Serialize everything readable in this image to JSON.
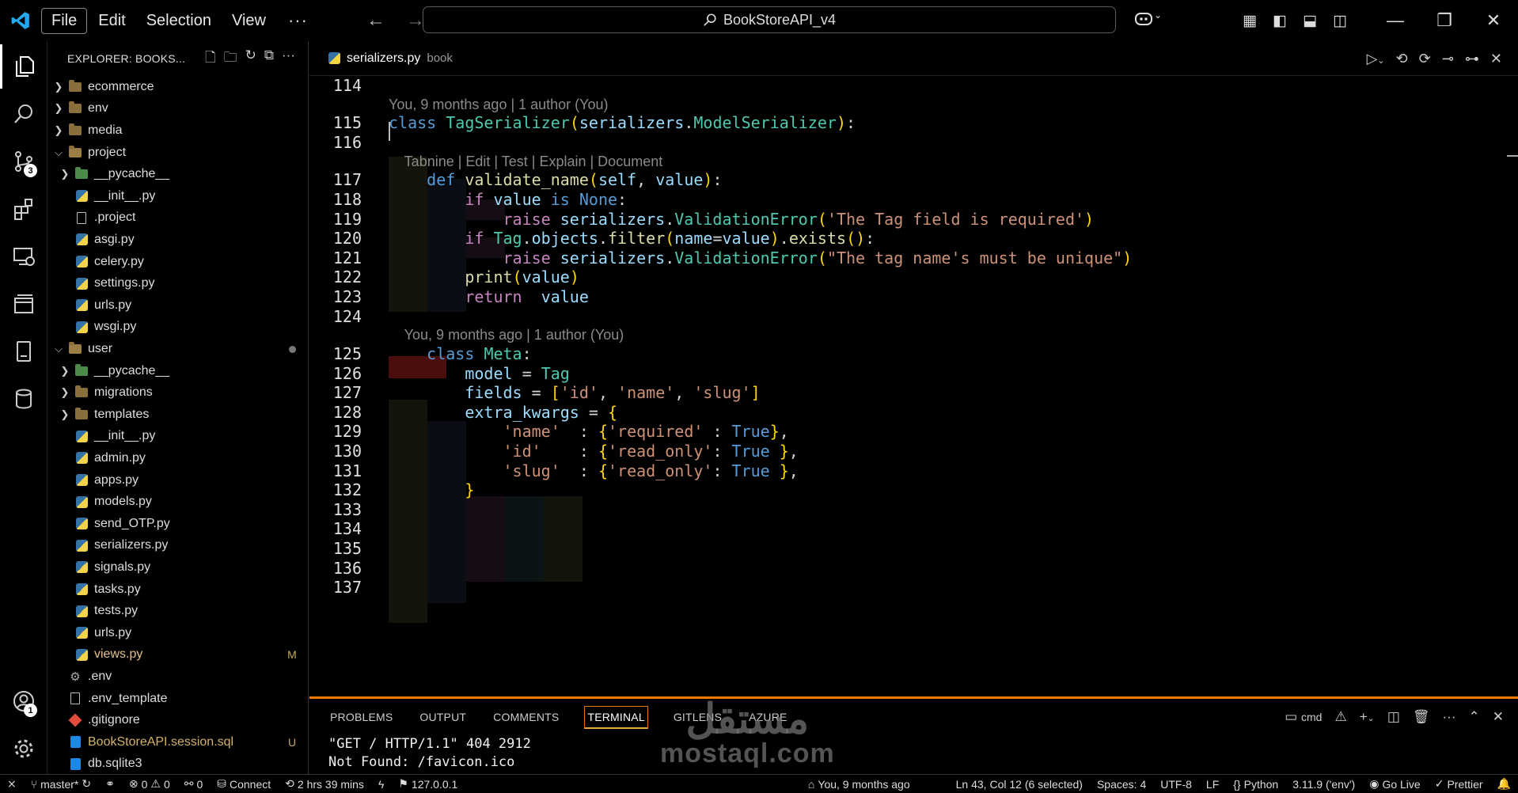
{
  "menu": {
    "file": "File",
    "edit": "Edit",
    "selection": "Selection",
    "view": "View",
    "more": "···"
  },
  "command_center": {
    "text": "BookStoreAPI_v4"
  },
  "activity": {
    "scm_badge": "3",
    "accounts_badge": "1"
  },
  "sidebar": {
    "title": "EXPLORER: BOOKS...",
    "items": [
      {
        "label": "ecommerce",
        "kind": "folder",
        "depth": 0,
        "chevron": "›",
        "status": ""
      },
      {
        "label": "env",
        "kind": "folder",
        "depth": 0,
        "chevron": "›",
        "status": ""
      },
      {
        "label": "media",
        "kind": "folder",
        "depth": 0,
        "chevron": "›",
        "status": ""
      },
      {
        "label": "project",
        "kind": "folder-open",
        "depth": 0,
        "chevron": "⌄",
        "status": ""
      },
      {
        "label": "__pycache__",
        "kind": "folder-green",
        "depth": 1,
        "chevron": "›",
        "status": ""
      },
      {
        "label": "__init__.py",
        "kind": "py",
        "depth": 1,
        "chevron": "",
        "status": ""
      },
      {
        "label": ".project",
        "kind": "doc",
        "depth": 1,
        "chevron": "",
        "status": ""
      },
      {
        "label": "asgi.py",
        "kind": "py",
        "depth": 1,
        "chevron": "",
        "status": ""
      },
      {
        "label": "celery.py",
        "kind": "py",
        "depth": 1,
        "chevron": "",
        "status": ""
      },
      {
        "label": "settings.py",
        "kind": "py",
        "depth": 1,
        "chevron": "",
        "status": ""
      },
      {
        "label": "urls.py",
        "kind": "py",
        "depth": 1,
        "chevron": "",
        "status": ""
      },
      {
        "label": "wsgi.py",
        "kind": "py",
        "depth": 1,
        "chevron": "",
        "status": ""
      },
      {
        "label": "user",
        "kind": "folder-open",
        "depth": 0,
        "chevron": "⌄",
        "status": "dot"
      },
      {
        "label": "__pycache__",
        "kind": "folder-green",
        "depth": 1,
        "chevron": "›",
        "status": ""
      },
      {
        "label": "migrations",
        "kind": "folder",
        "depth": 1,
        "chevron": "›",
        "status": ""
      },
      {
        "label": "templates",
        "kind": "folder",
        "depth": 1,
        "chevron": "›",
        "status": ""
      },
      {
        "label": "__init__.py",
        "kind": "py",
        "depth": 1,
        "chevron": "",
        "status": ""
      },
      {
        "label": "admin.py",
        "kind": "py",
        "depth": 1,
        "chevron": "",
        "status": ""
      },
      {
        "label": "apps.py",
        "kind": "py",
        "depth": 1,
        "chevron": "",
        "status": ""
      },
      {
        "label": "models.py",
        "kind": "py",
        "depth": 1,
        "chevron": "",
        "status": ""
      },
      {
        "label": "send_OTP.py",
        "kind": "py",
        "depth": 1,
        "chevron": "",
        "status": ""
      },
      {
        "label": "serializers.py",
        "kind": "py",
        "depth": 1,
        "chevron": "",
        "status": ""
      },
      {
        "label": "signals.py",
        "kind": "py",
        "depth": 1,
        "chevron": "",
        "status": ""
      },
      {
        "label": "tasks.py",
        "kind": "py",
        "depth": 1,
        "chevron": "",
        "status": ""
      },
      {
        "label": "tests.py",
        "kind": "py",
        "depth": 1,
        "chevron": "",
        "status": ""
      },
      {
        "label": "urls.py",
        "kind": "py",
        "depth": 1,
        "chevron": "",
        "status": ""
      },
      {
        "label": "views.py",
        "kind": "py",
        "depth": 1,
        "chevron": "",
        "status": "M"
      },
      {
        "label": ".env",
        "kind": "gear",
        "depth": 0,
        "chevron": "",
        "status": ""
      },
      {
        "label": ".env_template",
        "kind": "doc",
        "depth": 0,
        "chevron": "",
        "status": ""
      },
      {
        "label": ".gitignore",
        "kind": "git",
        "depth": 0,
        "chevron": "",
        "status": ""
      },
      {
        "label": "BookStoreAPI.session.sql",
        "kind": "sql",
        "depth": 0,
        "chevron": "",
        "status": "U"
      },
      {
        "label": "db.sqlite3",
        "kind": "sql",
        "depth": 0,
        "chevron": "",
        "status": ""
      }
    ]
  },
  "tab": {
    "name": "serializers.py",
    "desc": "book"
  },
  "editor": {
    "lines": [
      {
        "n": "114",
        "code": ""
      },
      {
        "lens": "You, 9 months ago | 1 author (You)"
      },
      {
        "n": "115",
        "code": "class TagSerializer(serializers.ModelSerializer):"
      },
      {
        "n": "116",
        "code": ""
      },
      {
        "lens": "    Tabnine | Edit | Test | Explain | Document"
      },
      {
        "n": "117",
        "code": "    def validate_name(self, value):"
      },
      {
        "n": "118",
        "code": "        if value is None:"
      },
      {
        "n": "119",
        "code": "            raise serializers.ValidationError('The Tag field is required')"
      },
      {
        "n": "120",
        "code": "        if Tag.objects.filter(name=value).exists():"
      },
      {
        "n": "121",
        "code": "            raise serializers.ValidationError(\"The tag name's must be unique\")"
      },
      {
        "n": "122",
        "code": "        print(value)"
      },
      {
        "n": "123",
        "code": "        return  value"
      },
      {
        "n": "124",
        "code": ""
      },
      {
        "lens": "    You, 9 months ago | 1 author (You)"
      },
      {
        "n": "125",
        "code": "    class Meta:"
      },
      {
        "n": "126",
        "code": "        model = Tag"
      },
      {
        "n": "127",
        "code": "        fields = ['id', 'name', 'slug']"
      },
      {
        "n": "128",
        "code": "        extra_kwargs = {"
      },
      {
        "n": "129",
        "code": "            'name'  : {'required' : True},"
      },
      {
        "n": "130",
        "code": "            'id'    : {'read_only': True },"
      },
      {
        "n": "131",
        "code": "            'slug'  : {'read_only': True },"
      },
      {
        "n": "132",
        "code": "        }"
      },
      {
        "n": "133",
        "code": ""
      },
      {
        "n": "134",
        "code": ""
      },
      {
        "n": "135",
        "code": ""
      },
      {
        "n": "136",
        "code": ""
      },
      {
        "n": "137",
        "code": ""
      }
    ]
  },
  "panel": {
    "tabs": [
      "PROBLEMS",
      "OUTPUT",
      "COMMENTS",
      "TERMINAL",
      "GITLENS",
      "AZURE"
    ],
    "active_tab": "TERMINAL",
    "shell": "cmd",
    "terminal_lines": [
      "\"GET / HTTP/1.1\" 404 2912",
      "Not Found: /favicon.ico"
    ]
  },
  "watermark": {
    "arabic": "مستقل",
    "latin": "mostaql.com"
  },
  "statusbar": {
    "branch": "master*",
    "errors": "0",
    "warnings": "0",
    "ports": "0",
    "connect": "Connect",
    "time": "2 hrs 39 mins",
    "host": "127.0.0.1",
    "blame": "You, 9 months ago",
    "position": "Ln 43, Col 12 (6 selected)",
    "spaces": "Spaces: 4",
    "encoding": "UTF-8",
    "eol": "LF",
    "language": "Python",
    "interpreter": "3.11.9 ('env')",
    "golive": "Go Live",
    "prettier": "Prettier"
  },
  "colors": {
    "accent_panel_border": "#f57c00",
    "modified": "#e2c08d",
    "keyword": "#569cd6",
    "class": "#4ec9b0",
    "function": "#dcdcaa",
    "string": "#ce9178"
  }
}
